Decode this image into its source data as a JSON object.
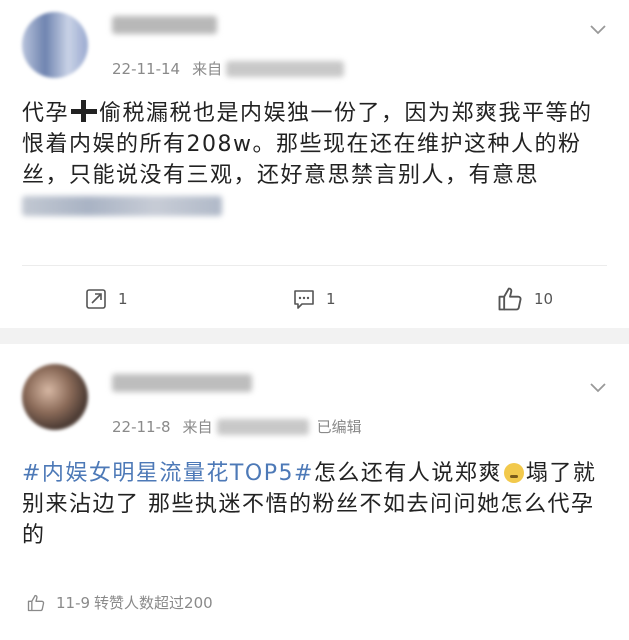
{
  "posts": [
    {
      "date": "22-11-14",
      "from_label": "来自",
      "body": {
        "part1": "代孕",
        "part2": "偷税漏税也是内娱独一份了，因为郑爽我平等的恨着内娱的所有208w。那些现在还在维护这种人的粉丝，只能说没有三观，还好意思禁言别人，有意思"
      },
      "actions": {
        "repost_count": "1",
        "comment_count": "1",
        "like_count": "10"
      }
    },
    {
      "date": "22-11-8",
      "from_label": "来自",
      "edited_label": "已编辑",
      "body": {
        "hashtag": "#内娱女明星流量花TOP5#",
        "part1": "怎么还有人说郑爽",
        "part2": "塌了就别来沾边了 那些执迷不悟的粉丝不如去问问她怎么代孕的"
      },
      "footer": {
        "date": "11-9",
        "text": "转赞人数超过200"
      }
    }
  ],
  "colors": {
    "hashtag": "#4d79b7",
    "meta_text": "#8a8a8a",
    "separator_bg": "#f2f2f2"
  },
  "icons": {
    "repost": "repost-icon",
    "comment": "comment-icon",
    "like": "thumbs-up-icon",
    "more": "chevron-down-icon",
    "cross": "cross-symbol",
    "emoji": "sleepy-face-emoji"
  }
}
